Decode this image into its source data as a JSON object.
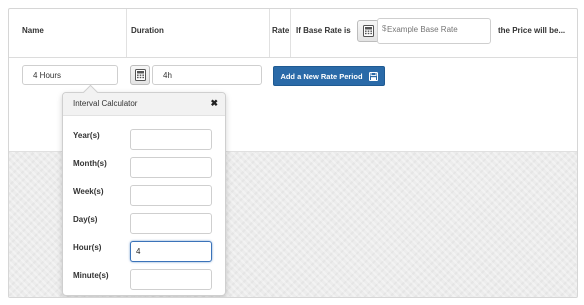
{
  "headers": {
    "name": "Name",
    "duration": "Duration",
    "rate": "Rate",
    "if_base_rate": "If Base Rate is",
    "price_will_be": "the Price will be..."
  },
  "base_rate_input": {
    "prefix": "$",
    "placeholder": "Example Base Rate",
    "value": ""
  },
  "row": {
    "name_value": "4 Hours",
    "duration_value": "4h"
  },
  "add_button": {
    "label": "Add a New Rate Period",
    "icon": "floppy-disk-icon"
  },
  "calculator": {
    "title": "Interval Calculator",
    "close_glyph": "✖",
    "fields": {
      "years": {
        "label": "Year(s)",
        "value": ""
      },
      "months": {
        "label": "Month(s)",
        "value": ""
      },
      "weeks": {
        "label": "Week(s)",
        "value": ""
      },
      "days": {
        "label": "Day(s)",
        "value": ""
      },
      "hours": {
        "label": "Hour(s)",
        "value": "4"
      },
      "minutes": {
        "label": "Minute(s)",
        "value": ""
      }
    }
  },
  "colors": {
    "primary_button": "#2a6aa8",
    "focus_border": "#3b73b9",
    "background_texture": "#ececec"
  }
}
